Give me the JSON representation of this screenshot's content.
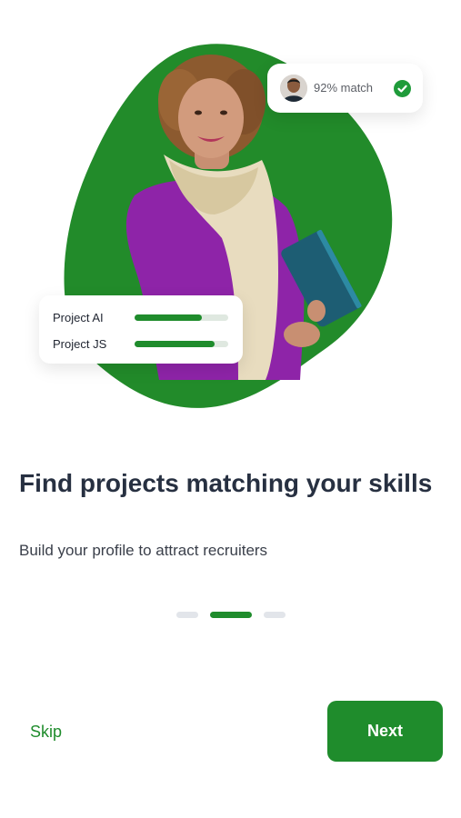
{
  "onboarding": {
    "title": "Find projects matching your skills",
    "subtitle": "Build your profile to attract recruiters",
    "match_badge": {
      "text": "92% match"
    },
    "projects": [
      {
        "label": "Project AI",
        "progress": 0.72
      },
      {
        "label": "Project JS",
        "progress": 0.85
      }
    ],
    "pager": {
      "total": 3,
      "active_index": 1
    }
  },
  "actions": {
    "skip_label": "Skip",
    "next_label": "Next"
  },
  "colors": {
    "accent": "#1f8c2c",
    "title_text": "#273041",
    "check": "#1f9b3a"
  }
}
